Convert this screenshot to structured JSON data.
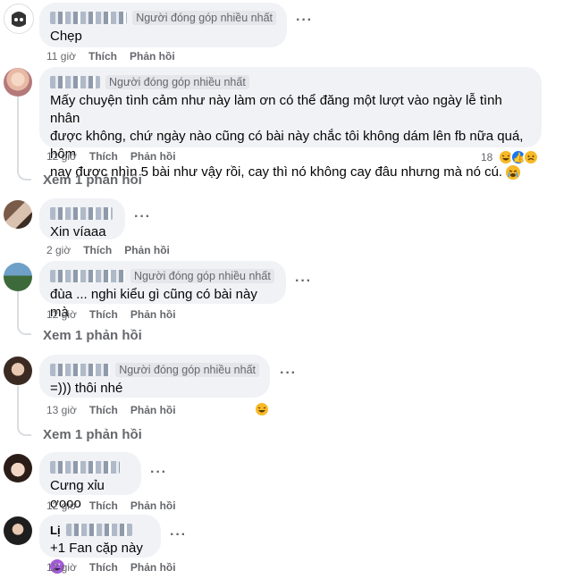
{
  "comments": [
    {
      "badge": "Người đóng góp nhiều nhất",
      "text": "Chẹp",
      "time": "11 giờ",
      "like": "Thích",
      "reply": "Phản hồi"
    },
    {
      "badge": "Người đóng góp nhiều nhất",
      "text": "Mấy chuyện tình cảm như này làm ơn có thể đăng một lượt vào ngày lễ tình nhân\nđược không, chứ ngày nào cũng có bài này chắc tôi không dám lên fb nữa quá, hôm\nnay được nhìn 5 bài như vậy rồi, cay thì nó không cay đâu nhưng mà nó cú. ",
      "time": "12 giờ",
      "like": "Thích",
      "reply": "Phản hồi",
      "reaction_count": "18",
      "view_replies": "Xem 1 phản hồi"
    },
    {
      "badge": "",
      "text": "Xin víaaa",
      "time": "2 giờ",
      "like": "Thích",
      "reply": "Phản hồi"
    },
    {
      "badge": "Người đóng góp nhiều nhất",
      "text": "đùa ... nghi kiểu gì cũng có bài này mà",
      "time": "12 giờ",
      "like": "Thích",
      "reply": "Phản hồi",
      "view_replies": "Xem 1 phản hồi"
    },
    {
      "badge": "Người đóng góp nhiều nhất",
      "text": "=))) thôi nhé",
      "time": "13 giờ",
      "like": "Thích",
      "reply": "Phản hồi",
      "view_replies": "Xem 1 phản hồi"
    },
    {
      "badge": "",
      "text": "Cưng xỉu ơooo",
      "time": "12 giờ",
      "like": "Thích",
      "reply": "Phản hồi"
    },
    {
      "badge": "",
      "name_prefix": "Lị",
      "text": "+1 Fan cặp này ",
      "time": "12 giờ",
      "like": "Thích",
      "reply": "Phản hồi"
    }
  ],
  "icons": {
    "more": "more-options-icon",
    "cry": "crying-emoji-icon",
    "laugh": "laughing-emoji-icon",
    "like": "like-reaction-icon",
    "heart_eyes": "heart-eyes-emoji-icon"
  },
  "colors": {
    "bubble": "#f0f2f5",
    "meta": "#65676b",
    "like_blue": "#1877f2"
  }
}
